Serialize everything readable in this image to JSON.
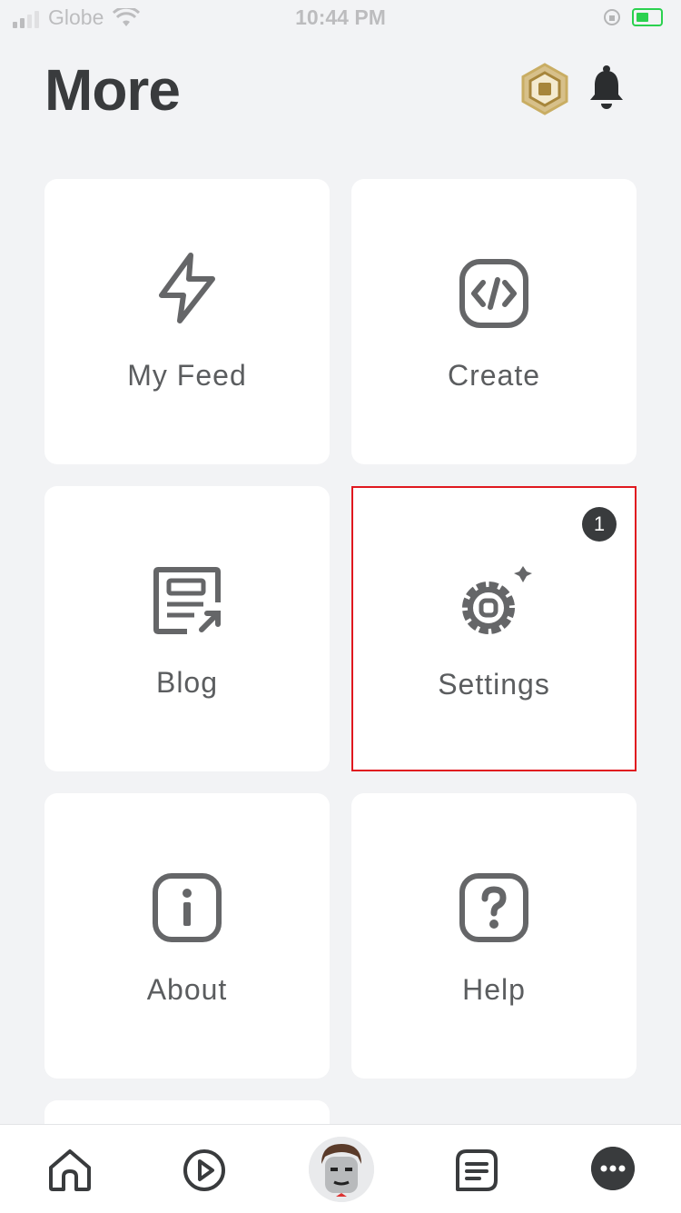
{
  "status_bar": {
    "carrier": "Globe",
    "time": "10:44 PM"
  },
  "header": {
    "title": "More"
  },
  "tiles": [
    {
      "label": "My Feed"
    },
    {
      "label": "Create"
    },
    {
      "label": "Blog"
    },
    {
      "label": "Settings",
      "badge": "1"
    },
    {
      "label": "About"
    },
    {
      "label": "Help"
    }
  ],
  "colors": {
    "highlight_border": "#e0181f",
    "text": "#393b3d",
    "battery": "#2bd14f"
  },
  "bottom_nav": [
    "home-icon",
    "discover-icon",
    "avatar",
    "chat-icon",
    "more-icon"
  ]
}
